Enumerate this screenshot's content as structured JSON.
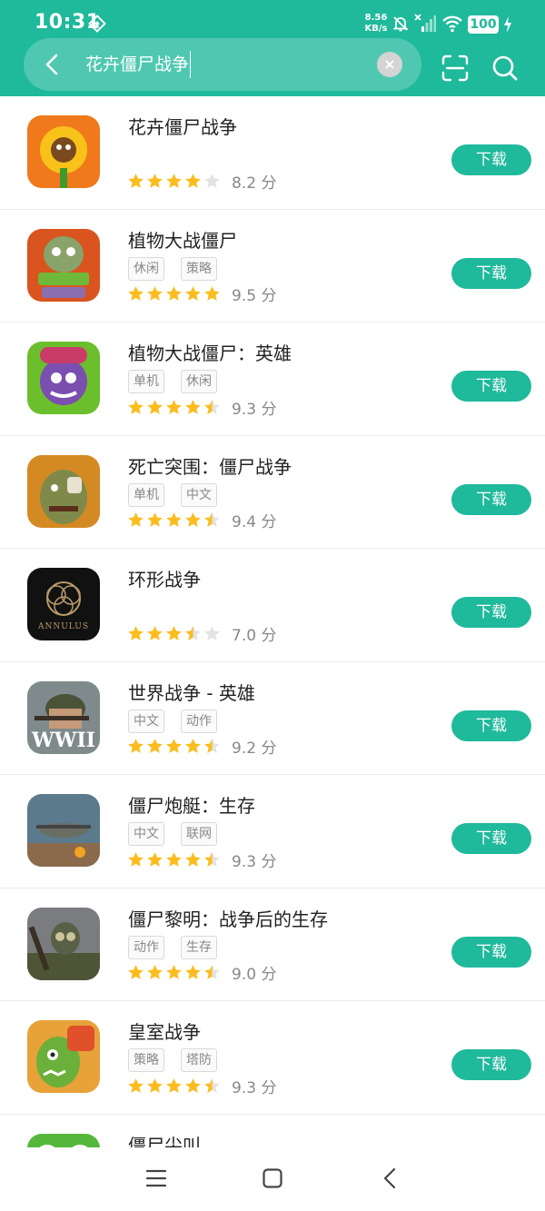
{
  "status_bar": {
    "time": "10:31",
    "net_speed_value": "8.56",
    "net_speed_unit": "KB/s",
    "battery": "100"
  },
  "search": {
    "query": "花卉僵尸战争",
    "clear_label": "×"
  },
  "download_label": "下载",
  "score_unit": "分",
  "colors": {
    "accent": "#1fb99b",
    "star": "#fbbd1e",
    "star_empty": "#e3e3e3"
  },
  "apps": [
    {
      "name": "花卉僵尸战争",
      "tags": [],
      "stars": 4,
      "score": "8.2",
      "icon": "sunflower-game-icon"
    },
    {
      "name": "植物大战僵尸",
      "tags": [
        "休闲",
        "策略"
      ],
      "stars": 5,
      "score": "9.5",
      "icon": "plants-vs-zombies-icon"
    },
    {
      "name": "植物大战僵尸：英雄",
      "tags": [
        "单机",
        "休闲"
      ],
      "stars": 4.5,
      "score": "9.3",
      "icon": "pvz-heroes-icon"
    },
    {
      "name": "死亡突围：僵尸战争",
      "tags": [
        "单机",
        "中文"
      ],
      "stars": 4.5,
      "score": "9.4",
      "icon": "zombie-escape-icon"
    },
    {
      "name": "环形战争",
      "tags": [],
      "stars": 3.5,
      "score": "7.0",
      "icon": "annulus-icon",
      "icon_text": "ANNULUS"
    },
    {
      "name": "世界战争 - 英雄",
      "tags": [
        "中文",
        "动作"
      ],
      "stars": 4.5,
      "score": "9.2",
      "icon": "ww2-soldier-icon",
      "icon_text": "WWII"
    },
    {
      "name": "僵尸炮艇：生存",
      "tags": [
        "中文",
        "联网"
      ],
      "stars": 4.5,
      "score": "9.3",
      "icon": "gunship-icon"
    },
    {
      "name": "僵尸黎明：战争后的生存",
      "tags": [
        "动作",
        "生存"
      ],
      "stars": 4.5,
      "score": "9.0",
      "icon": "survivor-gasmask-icon"
    },
    {
      "name": "皇室战争",
      "tags": [
        "策略",
        "塔防"
      ],
      "stars": 4.5,
      "score": "9.3",
      "icon": "clash-royale-icon"
    },
    {
      "name": "僵尸尖叫",
      "tags": [],
      "stars": 0,
      "score": "",
      "icon": "zombie-scream-icon"
    }
  ]
}
